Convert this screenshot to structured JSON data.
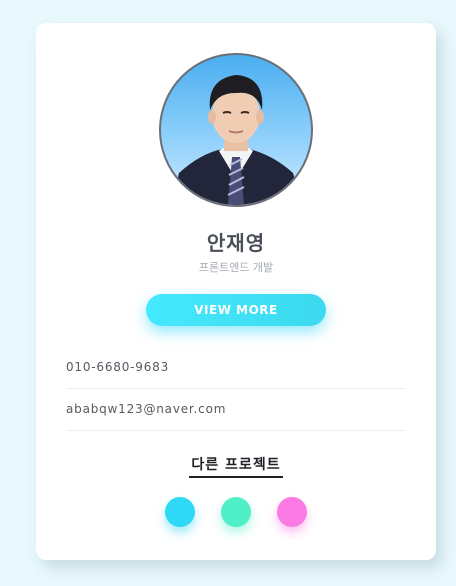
{
  "profile": {
    "name": "안재영",
    "role": "프론트엔드 개발",
    "view_more_label": "VIEW MORE",
    "phone": "010-6680-9683",
    "email": "ababqw123@naver.com"
  },
  "projects": {
    "title": "다른 프로젝트",
    "dots": [
      {
        "color": "#2fd9f5"
      },
      {
        "color": "#4ff0c8"
      },
      {
        "color": "#fb7ae4"
      }
    ]
  },
  "theme": {
    "background": "#e8f8fd",
    "accent": "#3cd9ee"
  }
}
